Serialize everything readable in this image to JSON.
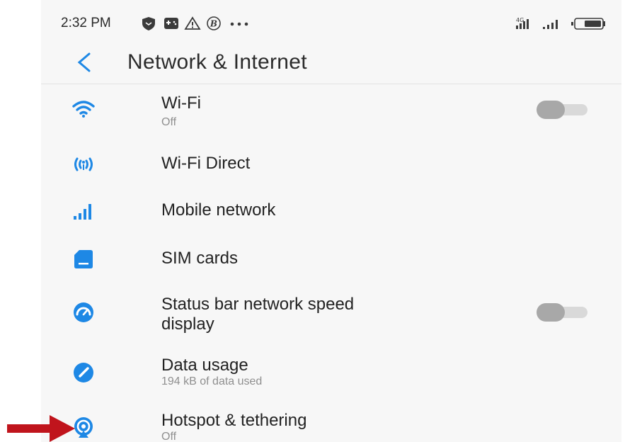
{
  "status_bar": {
    "time": "2:32 PM",
    "left_icons": [
      "shield-icon",
      "gamepad-icon",
      "warning-icon",
      "bitcoin-b-icon",
      "more-dots-icon"
    ],
    "right_icons": [
      "4g-signal-icon",
      "signal-icon",
      "battery-icon"
    ],
    "network_badge": "4G"
  },
  "header": {
    "back_icon": "back-chevron-icon",
    "title": "Network & Internet"
  },
  "settings": [
    {
      "id": "wifi",
      "icon": "wifi-icon",
      "title": "Wi-Fi",
      "subtitle": "Off",
      "toggle": false
    },
    {
      "id": "wifi-direct",
      "icon": "wifi-direct-icon",
      "title": "Wi-Fi Direct"
    },
    {
      "id": "mobile-network",
      "icon": "signal-bars-icon",
      "title": "Mobile network"
    },
    {
      "id": "sim-cards",
      "icon": "sim-card-icon",
      "title": "SIM cards"
    },
    {
      "id": "status-bar-speed",
      "icon": "speedometer-icon",
      "title_line1": "Status bar network speed",
      "title_line2": "display",
      "toggle": false
    },
    {
      "id": "data-usage",
      "icon": "data-usage-icon",
      "title": "Data usage",
      "subtitle": "194 kB of data used"
    },
    {
      "id": "hotspot",
      "icon": "hotspot-icon",
      "title": "Hotspot & tethering",
      "subtitle": "Off"
    }
  ],
  "colors": {
    "accent": "#1e88e5",
    "annotation_arrow": "#c0141c",
    "toggle_off_knob": "#a8a8a8",
    "toggle_off_track": "#d9d9d9"
  },
  "annotation": {
    "icon": "red-arrow-icon",
    "target": "hotspot"
  }
}
